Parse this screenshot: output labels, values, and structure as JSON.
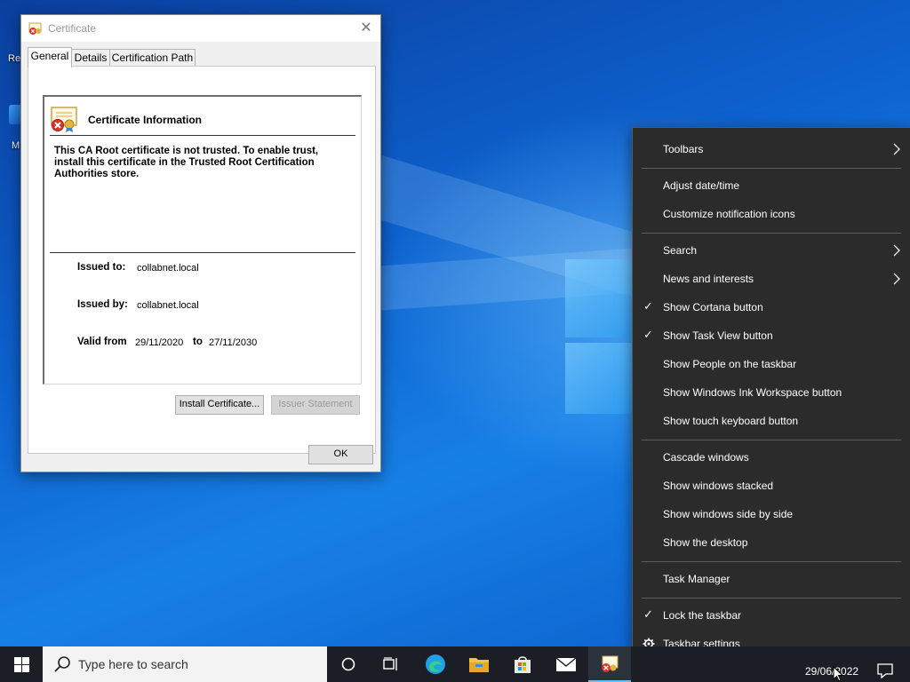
{
  "dialog": {
    "title": "Certificate",
    "close_glyph": "✕",
    "tabs": [
      {
        "label": "General",
        "active": true
      },
      {
        "label": "Details",
        "active": false
      },
      {
        "label": "Certification Path",
        "active": false
      }
    ],
    "heading": "Certificate Information",
    "trust_message": "This CA Root certificate is not trusted. To enable trust, install this certificate in the Trusted Root Certification Authorities store.",
    "issued_to_label": "Issued to:",
    "issued_to_value": "collabnet.local",
    "issued_by_label": "Issued by:",
    "issued_by_value": "collabnet.local",
    "valid_from_label": "Valid from",
    "valid_from_value": "29/11/2020",
    "valid_to_label": "to",
    "valid_to_value": "27/11/2030",
    "install_button": "Install Certificate...",
    "issuer_statement_button": "Issuer Statement",
    "ok_button": "OK",
    "icon": "certificate-untrusted-icon"
  },
  "context_menu": {
    "items": [
      {
        "label": "Toolbars",
        "submenu": true,
        "checked": false
      },
      {
        "label": "Adjust date/time",
        "submenu": false,
        "checked": false
      },
      {
        "label": "Customize notification icons",
        "submenu": false,
        "checked": false
      },
      {
        "label": "Search",
        "submenu": true,
        "checked": false
      },
      {
        "label": "News and interests",
        "submenu": true,
        "checked": false
      },
      {
        "label": "Show Cortana button",
        "submenu": false,
        "checked": true
      },
      {
        "label": "Show Task View button",
        "submenu": false,
        "checked": true
      },
      {
        "label": "Show People on the taskbar",
        "submenu": false,
        "checked": false
      },
      {
        "label": "Show Windows Ink Workspace button",
        "submenu": false,
        "checked": false
      },
      {
        "label": "Show touch keyboard button",
        "submenu": false,
        "checked": false
      },
      {
        "label": "Cascade windows",
        "submenu": false,
        "checked": false
      },
      {
        "label": "Show windows stacked",
        "submenu": false,
        "checked": false
      },
      {
        "label": "Show windows side by side",
        "submenu": false,
        "checked": false
      },
      {
        "label": "Show the desktop",
        "submenu": false,
        "checked": false
      },
      {
        "label": "Task Manager",
        "submenu": false,
        "checked": false
      },
      {
        "label": "Lock the taskbar",
        "submenu": false,
        "checked": true
      },
      {
        "label": "Taskbar settings",
        "submenu": false,
        "checked": false
      }
    ],
    "check_glyph": "✓"
  },
  "desktop": {
    "icon_labels": [
      "Re",
      "M"
    ]
  },
  "taskbar": {
    "search_placeholder": "Type here to search",
    "date": "29/06/2022",
    "icons": [
      "windows-start-icon",
      "cortana-icon",
      "task-view-icon",
      "edge-icon",
      "file-explorer-icon",
      "store-icon",
      "mail-icon",
      "certificate-icon"
    ]
  },
  "colors": {
    "menu_bg": "#2b2b2b",
    "taskbar_bg": "#1b1f25",
    "dialog_bg": "#f0f0f0",
    "accent": "#0078d7"
  }
}
